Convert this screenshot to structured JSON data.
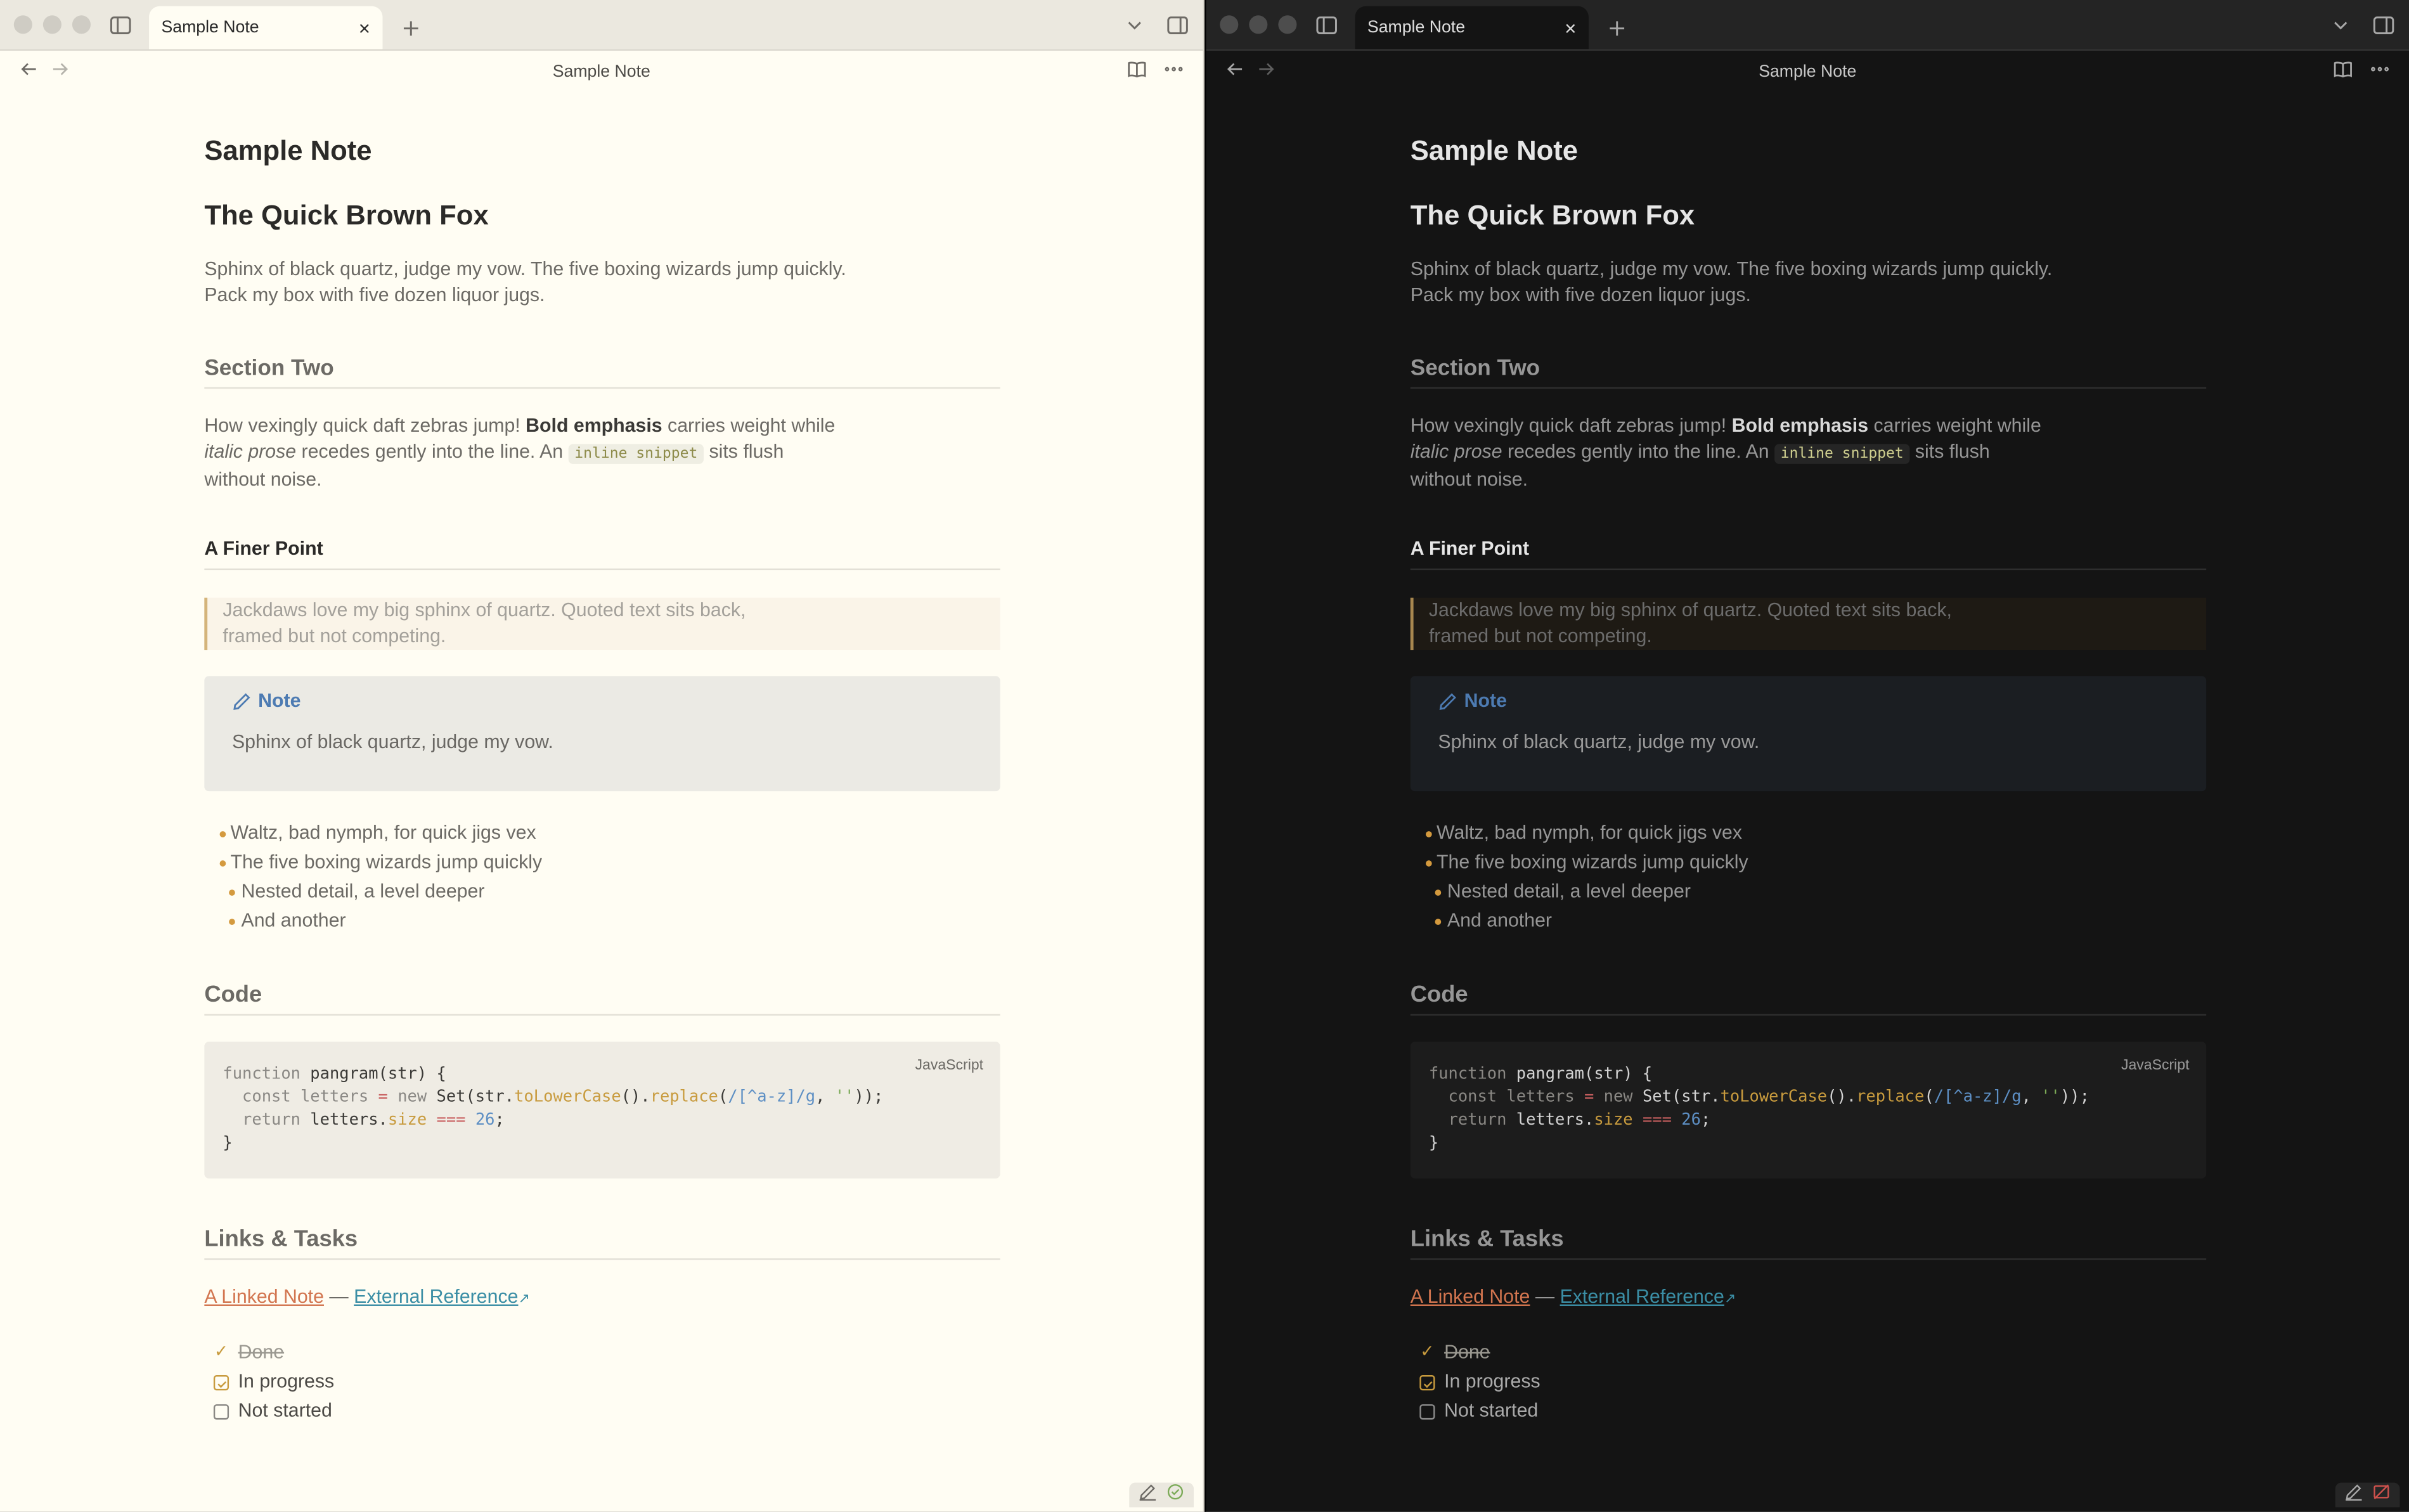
{
  "tab": {
    "title": "Sample Note",
    "close": "×"
  },
  "header": {
    "title": "Sample Note"
  },
  "doc": {
    "h1": "Sample Note",
    "h2": "The Quick Brown Fox",
    "para1_line1": "Sphinx of black quartz, judge my vow. The five boxing wizards jump quickly.",
    "para1_line2": "Pack my box with five dozen liquor jugs.",
    "section_two": "Section Two",
    "p2_a": "How vexingly quick daft zebras jump! ",
    "p2_bold": "Bold emphasis",
    "p2_b": " carries weight while",
    "p2_italic": "italic prose",
    "p2_c": " recedes gently into the line. An ",
    "p2_code": "inline snippet",
    "p2_d": " sits flush",
    "p2_e": "without noise.",
    "finer_point": "A Finer Point",
    "quote_line1": "Jackdaws love my big sphinx of quartz. Quoted text sits back,",
    "quote_line2": "framed but not competing.",
    "callout_title": "Note",
    "callout_body": "Sphinx of black quartz, judge my vow.",
    "list": [
      "Waltz, bad nymph, for quick jigs vex",
      "The five boxing wizards jump quickly",
      "Nested detail, a level deeper",
      "And another"
    ],
    "code_heading": "Code",
    "code_lang": "JavaScript",
    "code": {
      "l1_kw": "function",
      "l1_rest": " pangram(str) {",
      "l2_pre": "  const letters ",
      "l2_eq": "=",
      "l2_new": " new",
      "l2_set": " Set(str.",
      "l2_lower": "toLowerCase",
      "l2_mid": "().",
      "l2_replace": "replace",
      "l2_paren": "(",
      "l2_re": "/[^a-z]/g",
      "l2_comma": ", ",
      "l2_str": "''",
      "l2_end": "));",
      "l3_kw": "  return",
      "l3_a": " letters.",
      "l3_size": "size",
      "l3_op": " ===",
      "l3_num": " 26",
      "l3_end": ";",
      "l4": "}"
    },
    "links_heading": "Links & Tasks",
    "link_internal": "A Linked Note",
    "link_sep": " — ",
    "link_external": "External Reference",
    "tasks": [
      {
        "label": "Done",
        "state": "done"
      },
      {
        "label": "In progress",
        "state": "in-progress"
      },
      {
        "label": "Not started",
        "state": "open"
      }
    ]
  },
  "colors": {
    "light_bg": "#fffdf3",
    "dark_bg": "#141414",
    "accent_orange": "#d49a3e",
    "link_internal": "#d2754f",
    "link_external": "#3b8ea5",
    "callout_blue": "#4d7bb2"
  }
}
